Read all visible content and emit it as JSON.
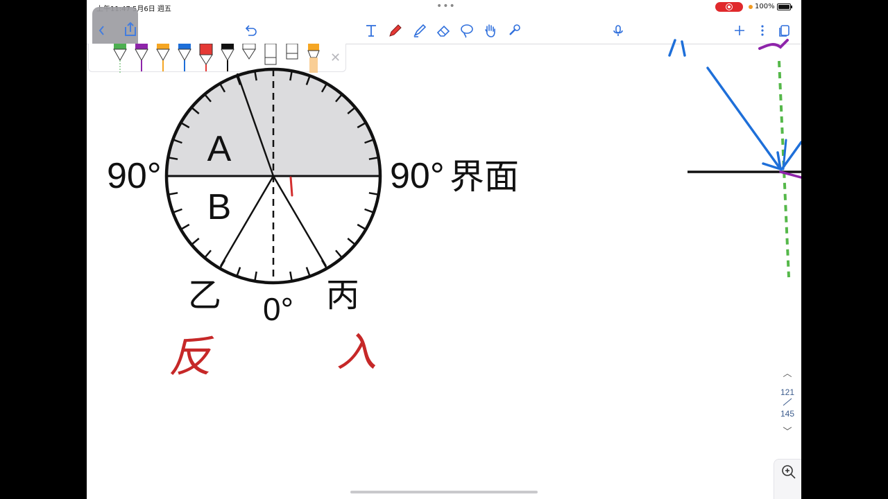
{
  "status": {
    "time_date": "上午11:47   5月6日 週五",
    "dots": "•••",
    "battery": "100%"
  },
  "toolbar": {
    "tools": [
      "text-tool-icon",
      "pen-tool-icon",
      "highlighter-icon",
      "eraser-icon",
      "lasso-icon",
      "hand-icon",
      "laser-pointer-icon"
    ],
    "colors": {
      "pen_green": "#4caf50",
      "pen_purple": "#8e24aa",
      "pen_orange": "#f5a623",
      "pen_blue": "#1e6fd9",
      "pen_red": "#e53935",
      "pen_black": "#111111",
      "highlighter": "#f7c27a"
    }
  },
  "canvas": {
    "label_a": "A",
    "label_b": "B",
    "left_angle": "90°",
    "right_angle": "90°",
    "interface": "界面",
    "bottom_angle": "0°",
    "label_yi": "乙",
    "label_bing": "丙",
    "handwriting_left": "反",
    "handwriting_right": "入"
  },
  "page_indicator": {
    "current": "121",
    "total": "145"
  }
}
